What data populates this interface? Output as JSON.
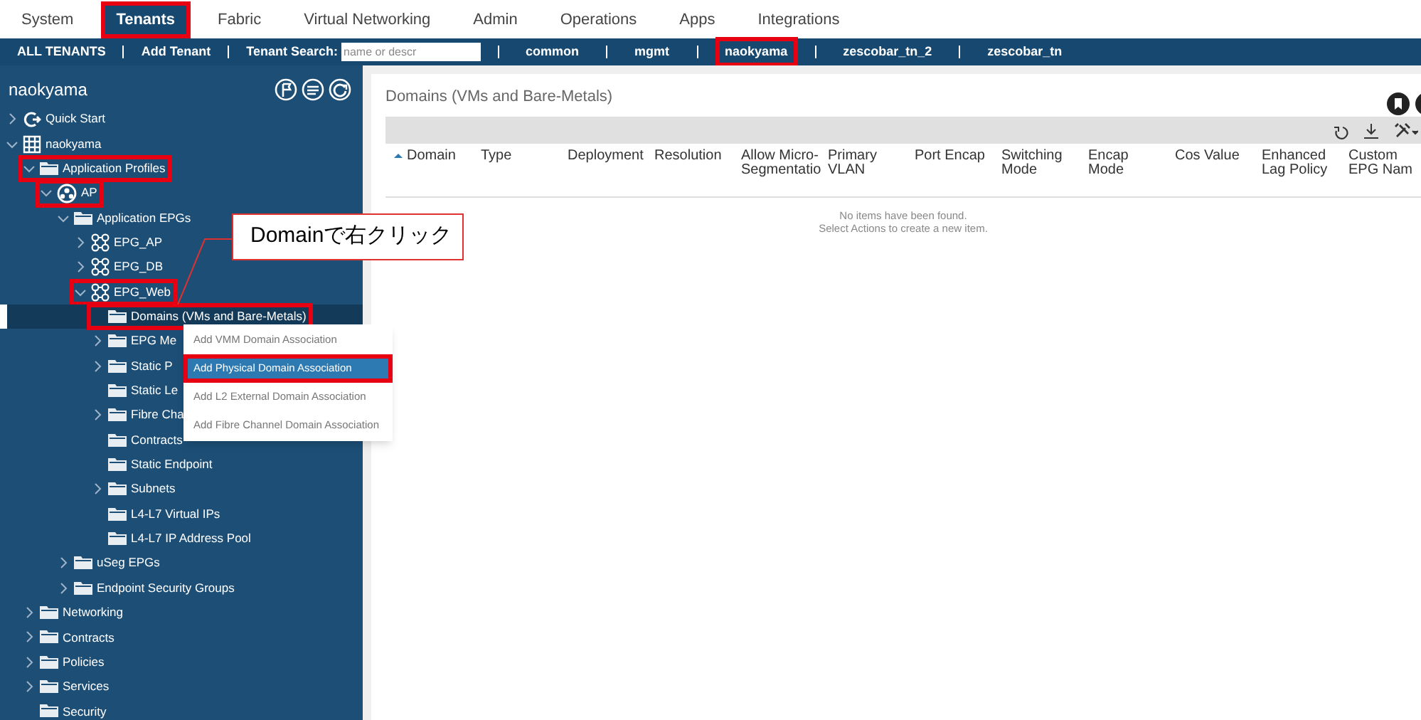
{
  "top_tabs": [
    {
      "label": "System",
      "selected": false,
      "highlighted": false
    },
    {
      "label": "Tenants",
      "selected": true,
      "highlighted": true
    },
    {
      "label": "Fabric",
      "selected": false,
      "highlighted": false
    },
    {
      "label": "Virtual Networking",
      "selected": false,
      "highlighted": false
    },
    {
      "label": "Admin",
      "selected": false,
      "highlighted": false
    },
    {
      "label": "Operations",
      "selected": false,
      "highlighted": false
    },
    {
      "label": "Apps",
      "selected": false,
      "highlighted": false
    },
    {
      "label": "Integrations",
      "selected": false,
      "highlighted": false
    }
  ],
  "tenant_bar": {
    "links_before": [
      "ALL TENANTS",
      "Add Tenant"
    ],
    "search_label": "Tenant Search:",
    "search_placeholder": "name or descr",
    "tenants": [
      {
        "label": "common",
        "highlighted": false
      },
      {
        "label": "mgmt",
        "highlighted": false
      },
      {
        "label": "naokyama",
        "highlighted": true
      },
      {
        "label": "zescobar_tn_2",
        "highlighted": false
      },
      {
        "label": "zescobar_tn",
        "highlighted": false
      }
    ]
  },
  "sidebar": {
    "title": "naokyama",
    "tree": [
      {
        "label": "Quick Start",
        "kind": "quickstart",
        "expanded": false,
        "highlighted": false,
        "selected": false
      },
      {
        "label": "naokyama",
        "kind": "tenant",
        "expanded": true,
        "highlighted": false,
        "selected": false,
        "children": [
          {
            "label": "Application Profiles",
            "kind": "folder",
            "expanded": true,
            "highlighted": true,
            "selected": false,
            "children": [
              {
                "label": "AP",
                "kind": "profile",
                "expanded": true,
                "highlighted": true,
                "selected": false,
                "children": [
                  {
                    "label": "Application EPGs",
                    "kind": "folder",
                    "expanded": true,
                    "highlighted": false,
                    "selected": false,
                    "children": [
                      {
                        "label": "EPG_AP",
                        "kind": "epg",
                        "expanded": false,
                        "highlighted": false,
                        "selected": false
                      },
                      {
                        "label": "EPG_DB",
                        "kind": "epg",
                        "expanded": false,
                        "highlighted": false,
                        "selected": false
                      },
                      {
                        "label": "EPG_Web",
                        "kind": "epg",
                        "expanded": true,
                        "highlighted": true,
                        "selected": false,
                        "children": [
                          {
                            "label": "Domains (VMs and Bare-Metals)",
                            "kind": "folder",
                            "highlighted": true,
                            "selected": true
                          },
                          {
                            "label": "EPG Me",
                            "kind": "folder",
                            "expanded": false,
                            "highlighted": false,
                            "selected": false
                          },
                          {
                            "label": "Static P",
                            "kind": "folder",
                            "expanded": false,
                            "highlighted": false,
                            "selected": false
                          },
                          {
                            "label": "Static Le",
                            "kind": "folder",
                            "highlighted": false,
                            "selected": false
                          },
                          {
                            "label": "Fibre Cha",
                            "kind": "folder",
                            "expanded": false,
                            "highlighted": false,
                            "selected": false
                          },
                          {
                            "label": "Contracts",
                            "kind": "folder",
                            "highlighted": false,
                            "selected": false
                          },
                          {
                            "label": "Static Endpoint",
                            "kind": "folder",
                            "highlighted": false,
                            "selected": false
                          },
                          {
                            "label": "Subnets",
                            "kind": "folder",
                            "expanded": false,
                            "highlighted": false,
                            "selected": false
                          },
                          {
                            "label": "L4-L7 Virtual IPs",
                            "kind": "folder",
                            "highlighted": false,
                            "selected": false
                          },
                          {
                            "label": "L4-L7 IP Address Pool",
                            "kind": "folder",
                            "highlighted": false,
                            "selected": false
                          }
                        ]
                      }
                    ]
                  },
                  {
                    "label": "uSeg EPGs",
                    "kind": "folder",
                    "expanded": false,
                    "highlighted": false,
                    "selected": false
                  },
                  {
                    "label": "Endpoint Security Groups",
                    "kind": "folder",
                    "expanded": false,
                    "highlighted": false,
                    "selected": false
                  }
                ]
              }
            ]
          },
          {
            "label": "Networking",
            "kind": "folder",
            "expanded": false,
            "highlighted": false,
            "selected": false
          },
          {
            "label": "Contracts",
            "kind": "folder",
            "expanded": false,
            "highlighted": false,
            "selected": false
          },
          {
            "label": "Policies",
            "kind": "folder",
            "expanded": false,
            "highlighted": false,
            "selected": false
          },
          {
            "label": "Services",
            "kind": "folder",
            "expanded": false,
            "highlighted": false,
            "selected": false
          },
          {
            "label": "Security",
            "kind": "folder",
            "highlighted": false,
            "selected": false
          }
        ]
      }
    ]
  },
  "context_menu": [
    {
      "label": "Add VMM Domain Association",
      "selected": false,
      "highlighted": false
    },
    {
      "label": "Add Physical Domain Association",
      "selected": true,
      "highlighted": true
    },
    {
      "label": "Add L2 External Domain Association",
      "selected": false,
      "highlighted": false
    },
    {
      "label": "Add Fibre Channel Domain Association",
      "selected": false,
      "highlighted": false
    }
  ],
  "callout": "Domainで右クリック",
  "panel": {
    "title": "Domains (VMs and Bare-Metals)",
    "columns": [
      {
        "label": "Domain",
        "sorted": true
      },
      {
        "label": "Type",
        "sorted": false
      },
      {
        "label": "Deployment",
        "sorted": false
      },
      {
        "label": "Resolution",
        "sorted": false
      },
      {
        "label": "Allow Micro-Segmentatio",
        "sorted": false
      },
      {
        "label": "Primary VLAN",
        "sorted": false
      },
      {
        "label": "Port Encap",
        "sorted": false
      },
      {
        "label": "Switching Mode",
        "sorted": false
      },
      {
        "label": "Encap Mode",
        "sorted": false
      },
      {
        "label": "Cos Value",
        "sorted": false
      },
      {
        "label": "Enhanced Lag Policy",
        "sorted": false
      },
      {
        "label": "Custom EPG Nam",
        "sorted": false
      }
    ],
    "empty_message": [
      "No items have been found.",
      "Select Actions to create a new item."
    ]
  }
}
